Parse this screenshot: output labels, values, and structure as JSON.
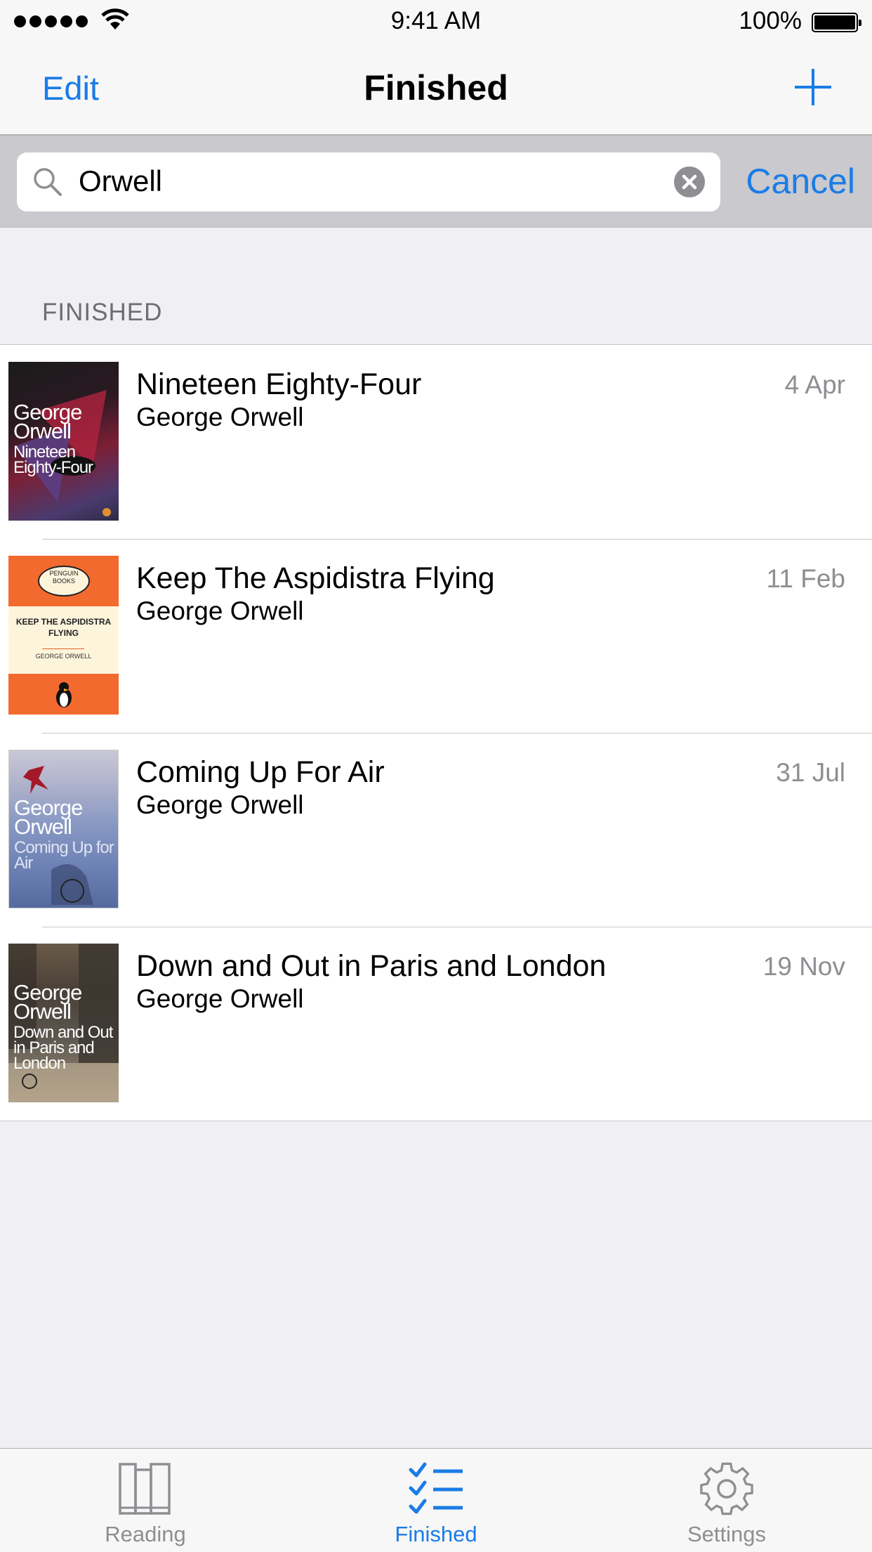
{
  "status_bar": {
    "time": "9:41 AM",
    "battery": "100%"
  },
  "nav": {
    "edit_label": "Edit",
    "title": "Finished",
    "add_icon": "plus-icon"
  },
  "search": {
    "value": "Orwell",
    "cancel_label": "Cancel"
  },
  "section": {
    "header": "FINISHED"
  },
  "books": [
    {
      "title": "Nineteen Eighty-Four",
      "author": "George Orwell",
      "date": "4 Apr",
      "cover_author": "George Orwell",
      "cover_title": "Nineteen Eighty-Four"
    },
    {
      "title": "Keep The Aspidistra Flying",
      "author": "George Orwell",
      "date": "11 Feb",
      "cover_publisher": "PENGUIN BOOKS",
      "cover_title": "KEEP THE ASPIDISTRA FLYING",
      "cover_author": "GEORGE ORWELL"
    },
    {
      "title": "Coming Up For Air",
      "author": "George Orwell",
      "date": "31 Jul",
      "cover_author": "George Orwell",
      "cover_title": "Coming Up for Air"
    },
    {
      "title": "Down and Out in Paris and London",
      "author": "George Orwell",
      "date": "19 Nov",
      "cover_author": "George Orwell",
      "cover_title": "Down and Out in Paris and London"
    }
  ],
  "tabs": [
    {
      "label": "Reading",
      "icon": "books-icon",
      "active": false
    },
    {
      "label": "Finished",
      "icon": "checklist-icon",
      "active": true
    },
    {
      "label": "Settings",
      "icon": "gear-icon",
      "active": false
    }
  ],
  "colors": {
    "accent": "#1a7ce6",
    "secondary_text": "#8e8e93",
    "background": "#efeff4"
  }
}
